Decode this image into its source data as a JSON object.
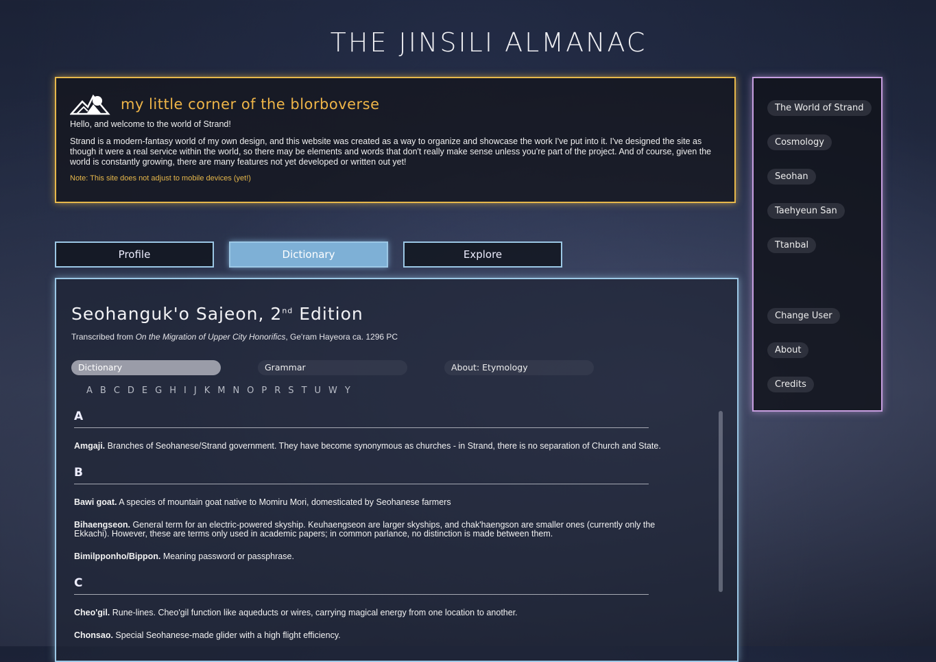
{
  "site_title": "THE JINSILI ALMANAC",
  "intro": {
    "heading": "my little corner of the blorboverse",
    "greeting": "Hello, and welcome to the world of Strand!",
    "body": "Strand is a modern-fantasy world of my own design, and this website was created as a way to organize and showcase the work I've put into it. I've designed the site as though it were a real service within the world, so there may be elements and words that don't really make sense unless you're part of the project. And of course, given the world is constantly growing, there are many features not yet developed or written out yet!",
    "note": "Note: This site does not adjust to mobile devices (yet!)"
  },
  "tabs": {
    "profile": "Profile",
    "dictionary": "Dictionary",
    "explore": "Explore"
  },
  "dictionary": {
    "title_main": "Seohanguk'o Sajeon, 2",
    "title_sup": "nd",
    "title_end": " Edition",
    "source_prefix": "Transcribed from ",
    "source_work": "On the Migration of Upper City Honorifics",
    "source_suffix": ", Ge'ram Hayeora ca. 1296 PC",
    "subtabs": {
      "dictionary": "Dictionary",
      "grammar": "Grammar",
      "etymology": "About: Etymology"
    },
    "letters": [
      "A",
      "B",
      "C",
      "D",
      "E",
      "G",
      "H",
      "I",
      "J",
      "K",
      "M",
      "N",
      "O",
      "P",
      "R",
      "S",
      "T",
      "U",
      "W",
      "Y"
    ],
    "sections": {
      "a": {
        "letter": "A",
        "e1": {
          "term": "Amgaji.",
          "def": " Branches of Seohanese/Strand government. They have become synonymous as churches - in Strand, there is no separation of Church and State."
        }
      },
      "b": {
        "letter": "B",
        "e1": {
          "term": "Bawi goat.",
          "def": " A species of mountain goat native to Momiru Mori, domesticated by Seohanese farmers"
        },
        "e2": {
          "term": "Bihaengseon.",
          "def": " General term for an electric-powered skyship. Keuhaengseon are larger skyships, and chak'haengson are smaller ones (currently only the Ekkachi). However, these are terms only used in academic papers; in common parlance, no distinction is made between them."
        },
        "e3": {
          "term": "Bimilpponho/Bippon.",
          "def": " Meaning password or passphrase."
        }
      },
      "c": {
        "letter": "C",
        "e1": {
          "term": "Cheo'gil.",
          "def": " Rune-lines. Cheo'gil function like aqueducts or wires, carrying magical energy from one location to another."
        },
        "e2": {
          "term": "Chonsao.",
          "def": " Special Seohanese-made glider with a high flight efficiency."
        }
      }
    }
  },
  "side_nav": {
    "world": "The World of Strand",
    "cosmology": "Cosmology",
    "seohan": "Seohan",
    "taehyeun": "Taehyeun San",
    "ttanbal": "Ttanbal",
    "change_user": "Change User",
    "about": "About",
    "credits": "Credits"
  },
  "colors": {
    "intro_border": "#e7b84b",
    "main_border": "#9cc8e6",
    "nav_border": "#c79ee0",
    "active_tab": "#7eb0d6"
  }
}
